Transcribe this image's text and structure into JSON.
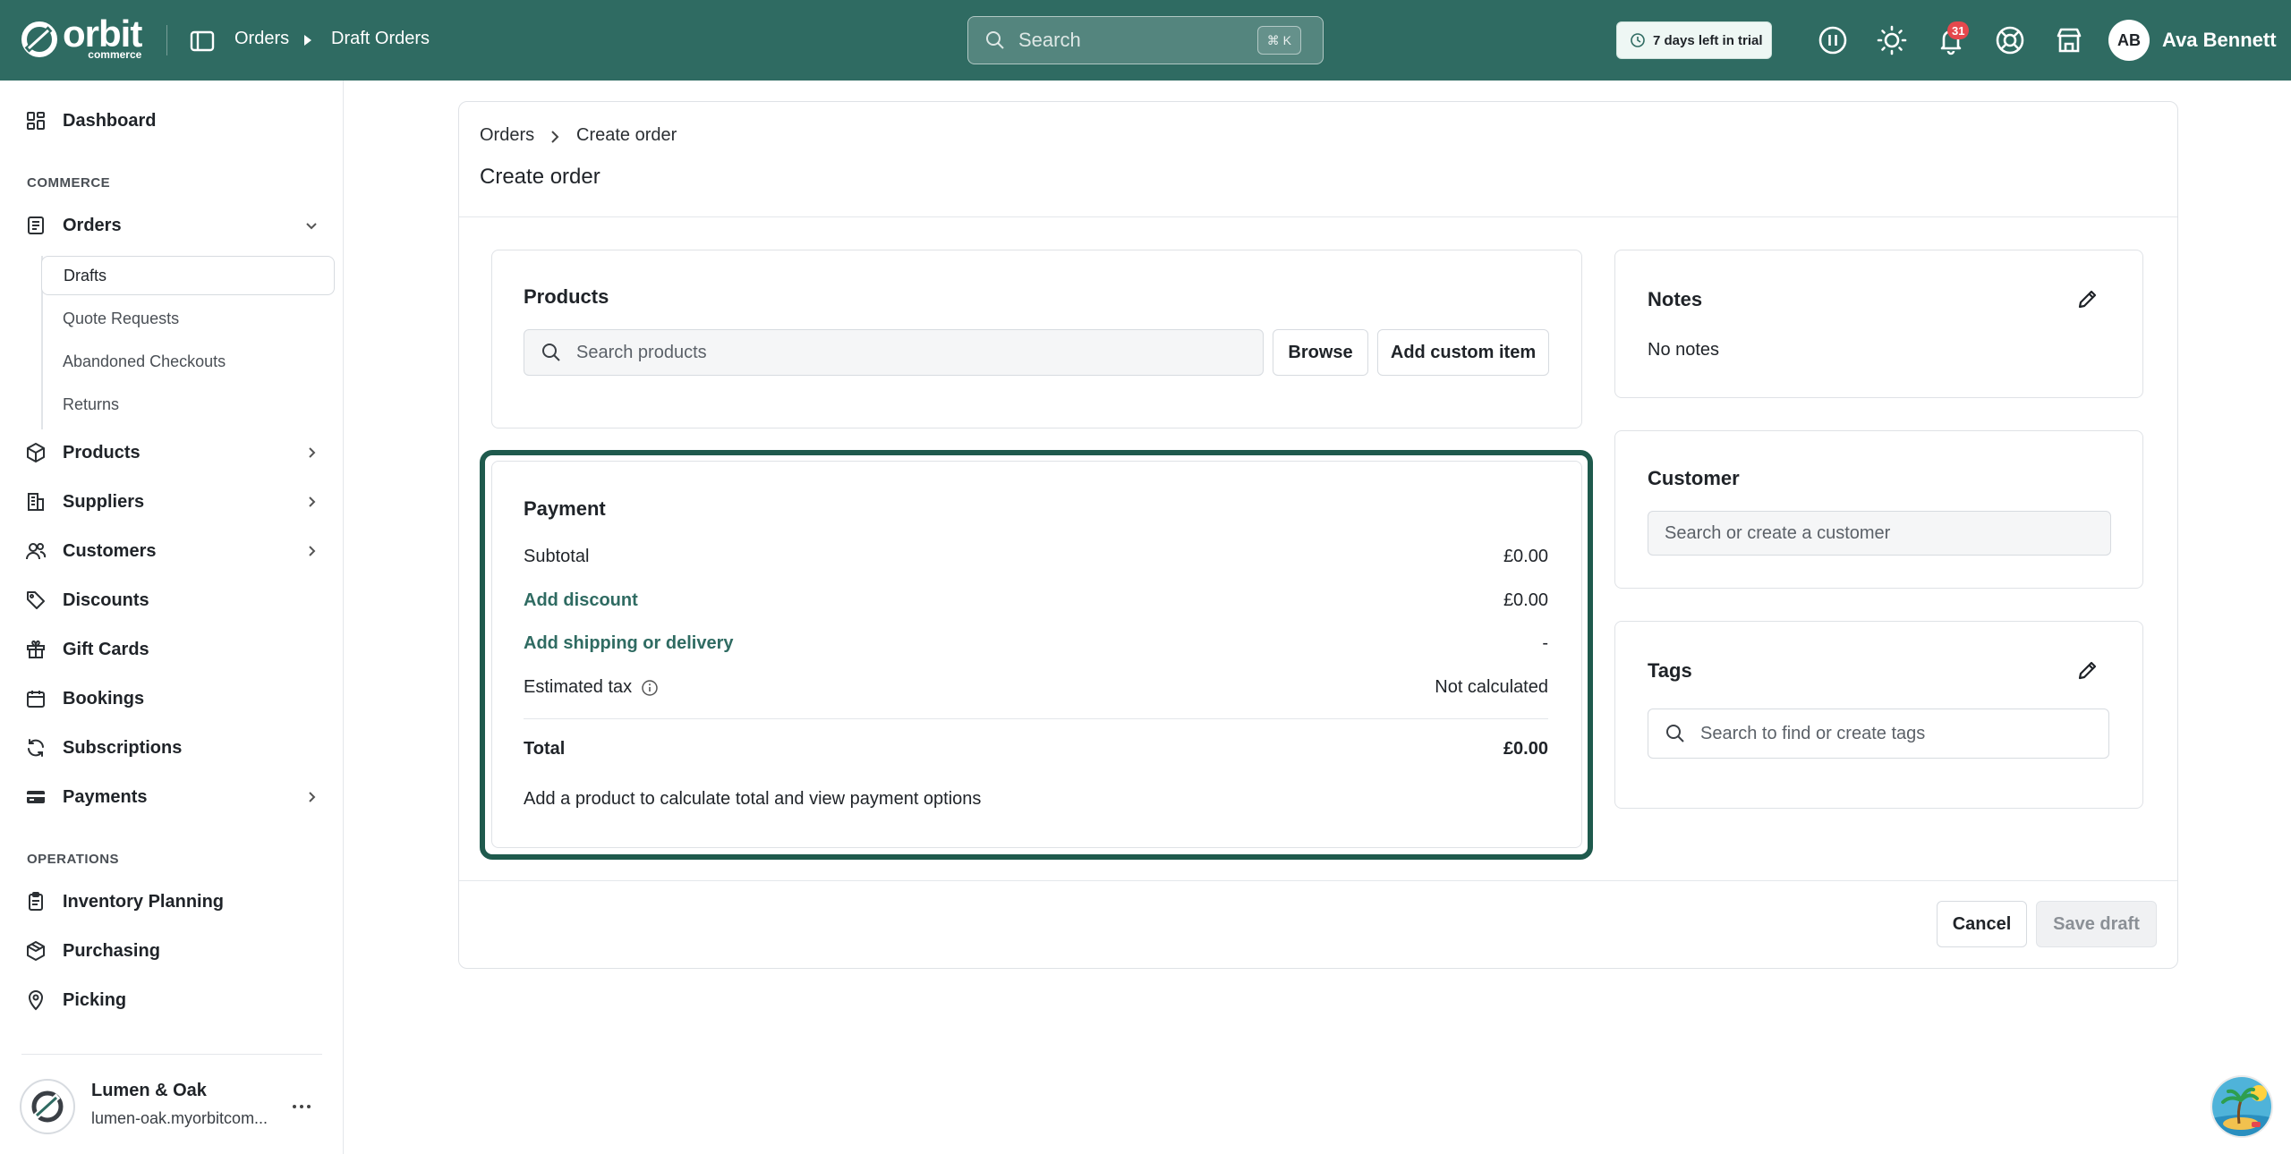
{
  "app": {
    "logo_word": "orbit",
    "logo_sub": "commerce",
    "breadcrumb": [
      "Orders",
      "Draft Orders"
    ],
    "search_placeholder": "Search",
    "search_shortcut": "⌘ K",
    "trial_text": "7 days left in trial",
    "notification_count": "31",
    "user_initials": "AB",
    "user_name": "Ava Bennett",
    "accent_color": "#2f6b62"
  },
  "sidebar": {
    "dashboard": "Dashboard",
    "commerce_label": "COMMERCE",
    "orders": "Orders",
    "order_subitems": [
      "Drafts",
      "Quote Requests",
      "Abandoned Checkouts",
      "Returns"
    ],
    "products": "Products",
    "suppliers": "Suppliers",
    "customers": "Customers",
    "discounts": "Discounts",
    "gift_cards": "Gift Cards",
    "bookings": "Bookings",
    "subscriptions": "Subscriptions",
    "payments": "Payments",
    "operations_label": "OPERATIONS",
    "inventory_planning": "Inventory Planning",
    "purchasing": "Purchasing",
    "picking": "Picking",
    "store_name": "Lumen & Oak",
    "store_url": "lumen-oak.myorbitcom..."
  },
  "page": {
    "breadcrumb": [
      "Orders",
      "Create order"
    ],
    "title": "Create order",
    "products": {
      "title": "Products",
      "search_placeholder": "Search products",
      "browse_label": "Browse",
      "add_custom_label": "Add custom item"
    },
    "payment": {
      "title": "Payment",
      "subtotal_label": "Subtotal",
      "subtotal_value": "£0.00",
      "discount_label": "Add discount",
      "discount_value": "£0.00",
      "shipping_label": "Add shipping or delivery",
      "shipping_value": "-",
      "tax_label": "Estimated tax",
      "tax_value": "Not calculated",
      "total_label": "Total",
      "total_value": "£0.00",
      "hint": "Add a product to calculate total and view payment options"
    },
    "notes": {
      "title": "Notes",
      "empty": "No notes"
    },
    "customer": {
      "title": "Customer",
      "search_placeholder": "Search or create a customer"
    },
    "tags": {
      "title": "Tags",
      "search_placeholder": "Search to find or create tags"
    },
    "cancel_label": "Cancel",
    "save_label": "Save draft"
  }
}
